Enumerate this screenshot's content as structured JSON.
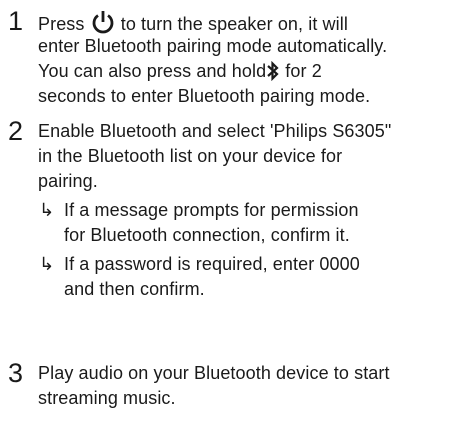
{
  "steps": [
    {
      "number": "1",
      "lines": {
        "l1_pre": "Press ",
        "l1_post": " to turn the speaker on, it will",
        "l2": "enter Bluetooth pairing mode automatically.",
        "l3_pre": "You can also press and hold",
        "l3_post": " for 2",
        "l4": "seconds to enter Bluetooth pairing mode."
      }
    },
    {
      "number": "2",
      "lines": {
        "l1": "Enable Bluetooth and select 'Philips S6305\"",
        "l2": "in the Bluetooth list on your device for",
        "l3": "pairing."
      },
      "sub_items": [
        {
          "arrow": "↳",
          "l1": "If a message prompts for permission",
          "l2": "for Bluetooth connection, confirm it."
        },
        {
          "arrow": "↳",
          "l1": "If a password is required, enter 0000",
          "l2": "and then confirm."
        }
      ]
    },
    {
      "number": "3",
      "lines": {
        "l1": "Play audio on your Bluetooth device to start",
        "l2": "streaming music."
      }
    }
  ],
  "icons": {
    "power": "power-icon",
    "bluetooth": "bluetooth-icon"
  }
}
